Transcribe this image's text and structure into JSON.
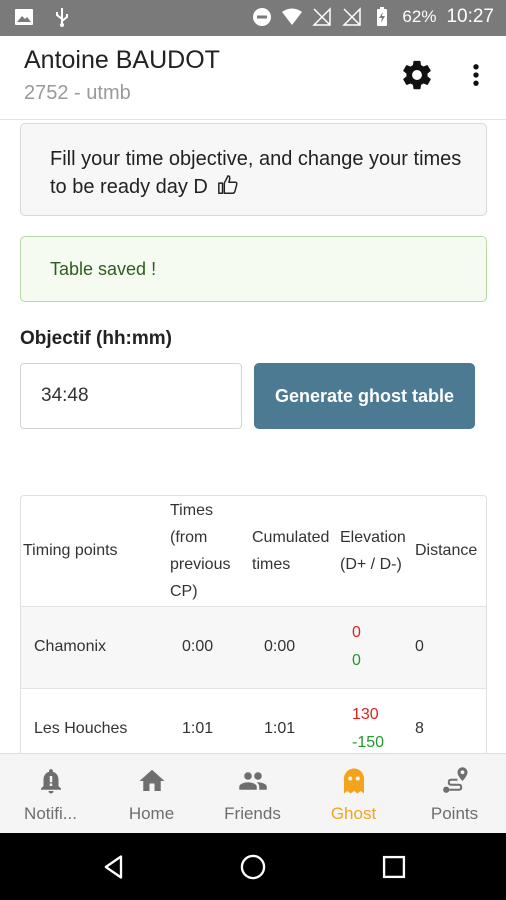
{
  "status_bar": {
    "battery": "62%",
    "time": "10:27"
  },
  "header": {
    "title": "Antoine BAUDOT",
    "subtitle": "2752 - utmb"
  },
  "info_card": {
    "text": "Fill your time objective, and change your times to be ready day D"
  },
  "alert": {
    "text": "Table saved !"
  },
  "objective": {
    "label": "Objectif (hh:mm)",
    "value": "34:48",
    "button_label": "Generate ghost table"
  },
  "table": {
    "headers": {
      "name": "Timing points",
      "times": "Times (from previous CP)",
      "cumulated": "Cumulated times",
      "elevation": "Elevation (D+ / D-)",
      "distance": "Distance"
    },
    "rows": [
      {
        "name": "Chamonix",
        "time": "0:00",
        "cumulated": "0:00",
        "elev_up": "0",
        "elev_down": "0",
        "distance": "0"
      },
      {
        "name": "Les Houches",
        "time": "1:01",
        "cumulated": "1:01",
        "elev_up": "130",
        "elev_down": "-150",
        "distance": "8"
      }
    ]
  },
  "bottom_nav": {
    "items": [
      {
        "label": "Notifi...",
        "icon": "bell-alert-icon"
      },
      {
        "label": "Home",
        "icon": "home-icon"
      },
      {
        "label": "Friends",
        "icon": "people-icon"
      },
      {
        "label": "Ghost",
        "icon": "ghost-icon"
      },
      {
        "label": "Points",
        "icon": "route-points-icon"
      }
    ],
    "active_color": "#f2a51c"
  },
  "colors": {
    "accent_button": "#4c7a93",
    "elevation_up": "#e02020",
    "elevation_down": "#1f9a2a",
    "alert_text": "#2f5d1e"
  }
}
